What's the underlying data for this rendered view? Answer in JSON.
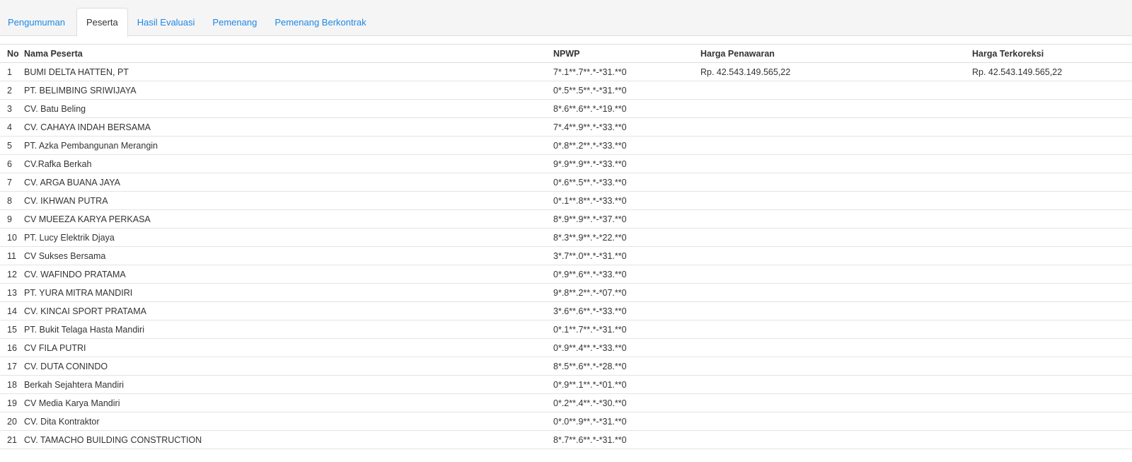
{
  "tabs": [
    {
      "label": "Pengumuman",
      "active": false
    },
    {
      "label": "Peserta",
      "active": true
    },
    {
      "label": "Hasil Evaluasi",
      "active": false
    },
    {
      "label": "Pemenang",
      "active": false
    },
    {
      "label": "Pemenang Berkontrak",
      "active": false
    }
  ],
  "colors": {
    "link": "#1e88e5",
    "text": "#333333",
    "border": "#dddddd",
    "tabbar_bg": "#f5f5f5"
  },
  "table": {
    "headers": {
      "no": "No",
      "name": "Nama Peserta",
      "npwp": "NPWP",
      "harga": "Harga Penawaran",
      "terkoreksi": "Harga Terkoreksi"
    },
    "rows": [
      {
        "no": "1",
        "name": "BUMI DELTA HATTEN, PT",
        "npwp": "7*.1**.7**.*-*31.**0",
        "harga": "Rp. 42.543.149.565,22",
        "terkoreksi": "Rp. 42.543.149.565,22"
      },
      {
        "no": "2",
        "name": "PT. BELIMBING SRIWIJAYA",
        "npwp": "0*.5**.5**.*-*31.**0",
        "harga": "",
        "terkoreksi": ""
      },
      {
        "no": "3",
        "name": "CV. Batu Beling",
        "npwp": "8*.6**.6**.*-*19.**0",
        "harga": "",
        "terkoreksi": ""
      },
      {
        "no": "4",
        "name": "CV. CAHAYA INDAH BERSAMA",
        "npwp": "7*.4**.9**.*-*33.**0",
        "harga": "",
        "terkoreksi": ""
      },
      {
        "no": "5",
        "name": "PT. Azka Pembangunan Merangin",
        "npwp": "0*.8**.2**.*-*33.**0",
        "harga": "",
        "terkoreksi": ""
      },
      {
        "no": "6",
        "name": "CV.Rafka Berkah",
        "npwp": "9*.9**.9**.*-*33.**0",
        "harga": "",
        "terkoreksi": ""
      },
      {
        "no": "7",
        "name": "CV. ARGA BUANA JAYA",
        "npwp": "0*.6**.5**.*-*33.**0",
        "harga": "",
        "terkoreksi": ""
      },
      {
        "no": "8",
        "name": "CV. IKHWAN PUTRA",
        "npwp": "0*.1**.8**.*-*33.**0",
        "harga": "",
        "terkoreksi": ""
      },
      {
        "no": "9",
        "name": "CV MUEEZA KARYA PERKASA",
        "npwp": "8*.9**.9**.*-*37.**0",
        "harga": "",
        "terkoreksi": ""
      },
      {
        "no": "10",
        "name": "PT. Lucy Elektrik Djaya",
        "npwp": "8*.3**.9**.*-*22.**0",
        "harga": "",
        "terkoreksi": ""
      },
      {
        "no": "11",
        "name": "CV Sukses Bersama",
        "npwp": "3*.7**.0**.*-*31.**0",
        "harga": "",
        "terkoreksi": ""
      },
      {
        "no": "12",
        "name": "CV. WAFINDO PRATAMA",
        "npwp": "0*.9**.6**.*-*33.**0",
        "harga": "",
        "terkoreksi": ""
      },
      {
        "no": "13",
        "name": "PT. YURA MITRA MANDIRI",
        "npwp": "9*.8**.2**.*-*07.**0",
        "harga": "",
        "terkoreksi": ""
      },
      {
        "no": "14",
        "name": "CV. KINCAI SPORT PRATAMA",
        "npwp": "3*.6**.6**.*-*33.**0",
        "harga": "",
        "terkoreksi": ""
      },
      {
        "no": "15",
        "name": "PT. Bukit Telaga Hasta Mandiri",
        "npwp": "0*.1**.7**.*-*31.**0",
        "harga": "",
        "terkoreksi": ""
      },
      {
        "no": "16",
        "name": "CV FILA PUTRI",
        "npwp": "0*.9**.4**.*-*33.**0",
        "harga": "",
        "terkoreksi": ""
      },
      {
        "no": "17",
        "name": "CV. DUTA CONINDO",
        "npwp": "8*.5**.6**.*-*28.**0",
        "harga": "",
        "terkoreksi": ""
      },
      {
        "no": "18",
        "name": "Berkah Sejahtera Mandiri",
        "npwp": "0*.9**.1**.*-*01.**0",
        "harga": "",
        "terkoreksi": ""
      },
      {
        "no": "19",
        "name": "CV Media Karya Mandiri",
        "npwp": "0*.2**.4**.*-*30.**0",
        "harga": "",
        "terkoreksi": ""
      },
      {
        "no": "20",
        "name": "CV. Dita Kontraktor",
        "npwp": "0*.0**.9**.*-*31.**0",
        "harga": "",
        "terkoreksi": ""
      },
      {
        "no": "21",
        "name": "CV. TAMACHO BUILDING CONSTRUCTION",
        "npwp": "8*.7**.6**.*-*31.**0",
        "harga": "",
        "terkoreksi": ""
      }
    ]
  }
}
